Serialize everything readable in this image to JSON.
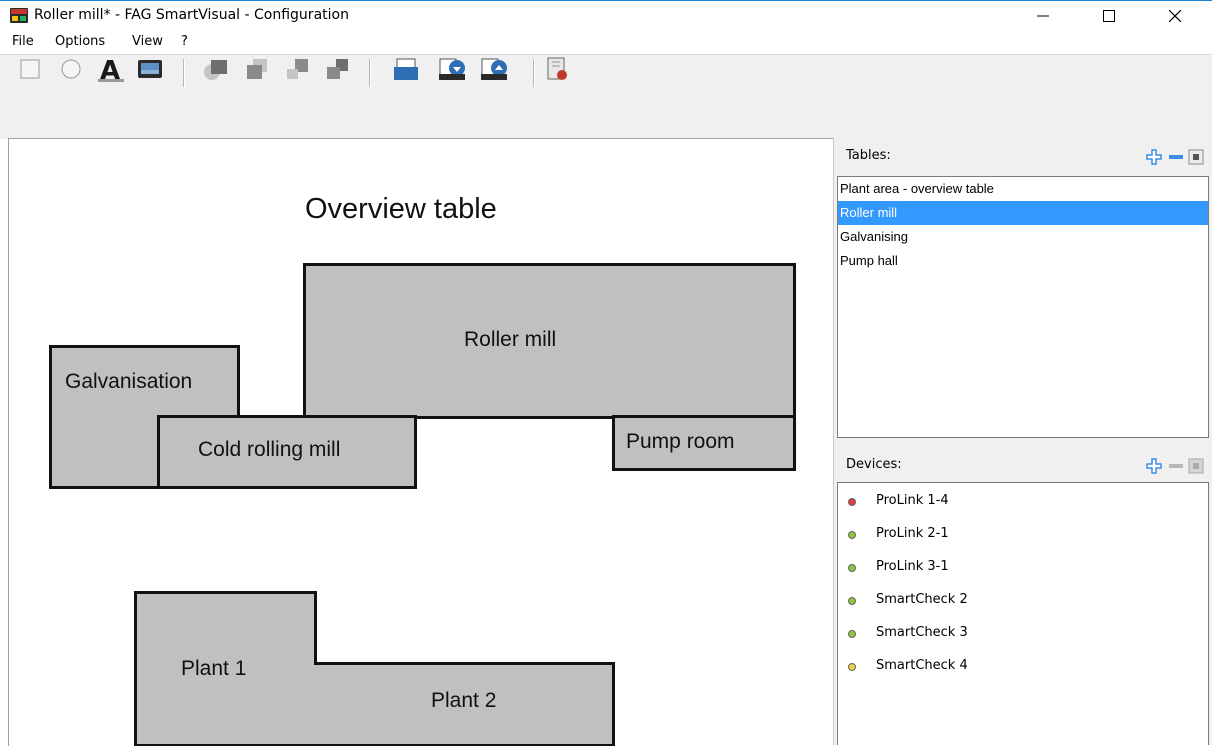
{
  "window": {
    "title": "Roller mill* - FAG SmartVisual - Configuration",
    "minimize_symbol": "—",
    "maximize_symbol": "☐",
    "close_symbol": "✕"
  },
  "menu": [
    {
      "label": "File"
    },
    {
      "label": "Options"
    },
    {
      "label": "View"
    },
    {
      "label": "?"
    }
  ],
  "toolbar": {
    "icons": [
      "rectangle-icon",
      "circle-icon",
      "text-icon",
      "image-icon",
      "bring-to-front-icon",
      "send-to-back-icon",
      "bring-forward-icon",
      "send-backward-icon",
      "open-file-icon",
      "import-icon",
      "export-icon",
      "settings-table-icon"
    ]
  },
  "canvas": {
    "title": "Overview table",
    "areas": [
      {
        "name": "roller-mill",
        "label": "Roller mill"
      },
      {
        "name": "galvanisation",
        "label": "Galvanisation"
      },
      {
        "name": "cold-rolling-mill",
        "label": "Cold rolling mill"
      },
      {
        "name": "pump-room",
        "label": "Pump room"
      },
      {
        "name": "plant-1",
        "label": "Plant 1"
      },
      {
        "name": "plant-2",
        "label": "Plant 2"
      }
    ]
  },
  "tables_panel": {
    "label": "Tables:",
    "items": [
      {
        "label": "Plant area - overview table",
        "selected": false
      },
      {
        "label": "Roller mill",
        "selected": true
      },
      {
        "label": "Galvanising",
        "selected": false
      },
      {
        "label": "Pump hall",
        "selected": false
      }
    ]
  },
  "devices_panel": {
    "label": "Devices:",
    "items": [
      {
        "label": "ProLink 1-4",
        "status_color": "#e0403c"
      },
      {
        "label": "ProLink 2-1",
        "status_color": "#8cc63f"
      },
      {
        "label": "ProLink 3-1",
        "status_color": "#8cc63f"
      },
      {
        "label": "SmartCheck 2",
        "status_color": "#8cc63f"
      },
      {
        "label": "SmartCheck 3",
        "status_color": "#8cc63f"
      },
      {
        "label": "SmartCheck 4",
        "status_color": "#e8d44a"
      }
    ]
  },
  "colors": {
    "accent_plus": "#3a8ee6",
    "selection": "#3399ff",
    "area_fill": "#c0c0c0"
  }
}
